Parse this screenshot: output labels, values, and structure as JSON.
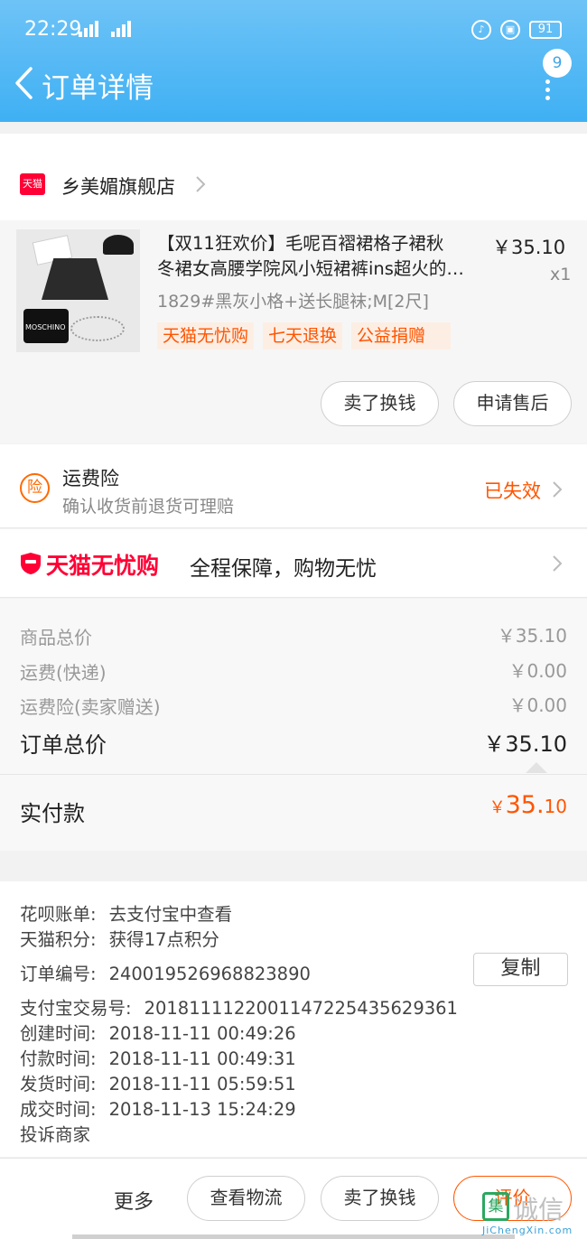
{
  "status": {
    "time": "22:29",
    "sig1": "4G",
    "sig2": "4G",
    "battery": "91"
  },
  "header": {
    "title": "订单详情",
    "badge": "9"
  },
  "shop": {
    "badge": "天猫",
    "name": "乡美媚旗舰店"
  },
  "product": {
    "title_line1": "【双11狂欢价】毛呢百褶裙格子裙秋",
    "title_line2": "冬裙女高腰学院风小短裙裤ins超火的…",
    "price": "￥35.10",
    "qty": "x1",
    "sku": "1829#黑灰小格+送长腿袜;M[2尺]",
    "tags": [
      "天猫无忧购",
      "七天退换",
      "公益捐赠"
    ],
    "image_text": "MOSCHINO",
    "btn_sell": "卖了换钱",
    "btn_aftersale": "申请售后"
  },
  "insurance": {
    "icon": "险",
    "title": "运费险",
    "subtitle": "确认收货前退货可理赔",
    "status": "已失效"
  },
  "worry": {
    "brand": "天猫无忧购",
    "text": "全程保障，购物无忧"
  },
  "summary": {
    "rows": [
      {
        "label": "商品总价",
        "value": "￥35.10"
      },
      {
        "label": "运费(快递)",
        "value": "￥0.00"
      },
      {
        "label": "运费险(卖家赠送)",
        "value": "￥0.00"
      }
    ],
    "total_label": "订单总价",
    "total_value": "￥35.10",
    "paid_label": "实付款",
    "paid_currency": "￥",
    "paid_int": "35.",
    "paid_dec": "10"
  },
  "info": {
    "rows": [
      {
        "key": "花呗账单:",
        "value": "去支付宝中查看"
      },
      {
        "key": "天猫积分:",
        "value": "获得17点积分"
      },
      {
        "key": "订单编号:",
        "value": "240019526968823890"
      },
      {
        "key": "支付宝交易号:",
        "value": "2018111122001147225435629361"
      },
      {
        "key": "创建时间:",
        "value": "2018-11-11 00:49:26"
      },
      {
        "key": "付款时间:",
        "value": "2018-11-11 00:49:31"
      },
      {
        "key": "发货时间:",
        "value": "2018-11-11 05:59:51"
      },
      {
        "key": "成交时间:",
        "value": "2018-11-13 15:24:29"
      }
    ],
    "complain": "投诉商家",
    "copy": "复制"
  },
  "bottom": {
    "more": "更多",
    "logistics": "查看物流",
    "sell": "卖了换钱",
    "rate": "评价"
  },
  "watermark": {
    "logo": "集",
    "text": "诚信",
    "url": "JiChengXin.com"
  },
  "colors": {
    "header": "#3fb0f4",
    "accent": "#ff5500",
    "tmall_red": "#ff0036"
  }
}
